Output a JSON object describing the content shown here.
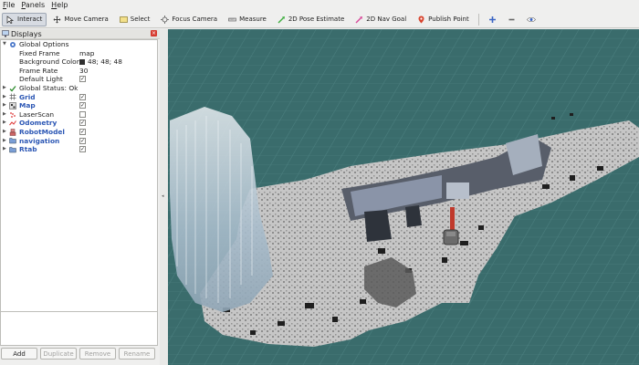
{
  "menubar": {
    "items": [
      {
        "label_ul": "F",
        "label_rest": "ile"
      },
      {
        "label_ul": "P",
        "label_rest": "anels"
      },
      {
        "label_ul": "H",
        "label_rest": "elp"
      }
    ]
  },
  "toolbar": {
    "tools": [
      {
        "label": "Interact",
        "icon": "interact-icon",
        "active": true
      },
      {
        "label": "Move Camera",
        "icon": "move-camera-icon",
        "active": false
      },
      {
        "label": "Select",
        "icon": "select-icon",
        "active": false
      },
      {
        "label": "Focus Camera",
        "icon": "focus-camera-icon",
        "active": false
      },
      {
        "label": "Measure",
        "icon": "measure-icon",
        "active": false
      },
      {
        "label": "2D Pose Estimate",
        "icon": "pose-estimate-icon",
        "active": false
      },
      {
        "label": "2D Nav Goal",
        "icon": "nav-goal-icon",
        "active": false
      },
      {
        "label": "Publish Point",
        "icon": "publish-point-icon",
        "active": false
      }
    ],
    "extra_icons": [
      "plus-icon",
      "minus-icon",
      "eye-icon"
    ]
  },
  "displays": {
    "title": "Displays",
    "global_options": {
      "label": "Global Options",
      "fixed_frame": {
        "label": "Fixed Frame",
        "value": "map"
      },
      "background_color": {
        "label": "Background Color",
        "value": "48; 48; 48",
        "color": "#303030"
      },
      "frame_rate": {
        "label": "Frame Rate",
        "value": "30"
      },
      "default_light": {
        "label": "Default Light",
        "checked": true
      }
    },
    "global_status": {
      "label": "Global Status: Ok"
    },
    "items": [
      {
        "label": "Grid",
        "checked": true,
        "icon": "grid-icon"
      },
      {
        "label": "Map",
        "checked": true,
        "icon": "map-icon"
      },
      {
        "label": "LaserScan",
        "checked": false,
        "icon": "laserscan-icon"
      },
      {
        "label": "Odometry",
        "checked": true,
        "icon": "odometry-icon"
      },
      {
        "label": "RobotModel",
        "checked": true,
        "icon": "robotmodel-icon"
      },
      {
        "label": "navigation",
        "checked": true,
        "icon": "folder-icon"
      },
      {
        "label": "Rtab",
        "checked": true,
        "icon": "folder-icon"
      }
    ]
  },
  "buttons": {
    "add": "Add",
    "duplicate": "Duplicate",
    "remove": "Remove",
    "rename": "Rename"
  },
  "colors": {
    "viewport_background": "#303030",
    "floor_color": "#c8c8c8",
    "status_ok": "#2a8a2a",
    "blue_label": "#2b56b4"
  }
}
